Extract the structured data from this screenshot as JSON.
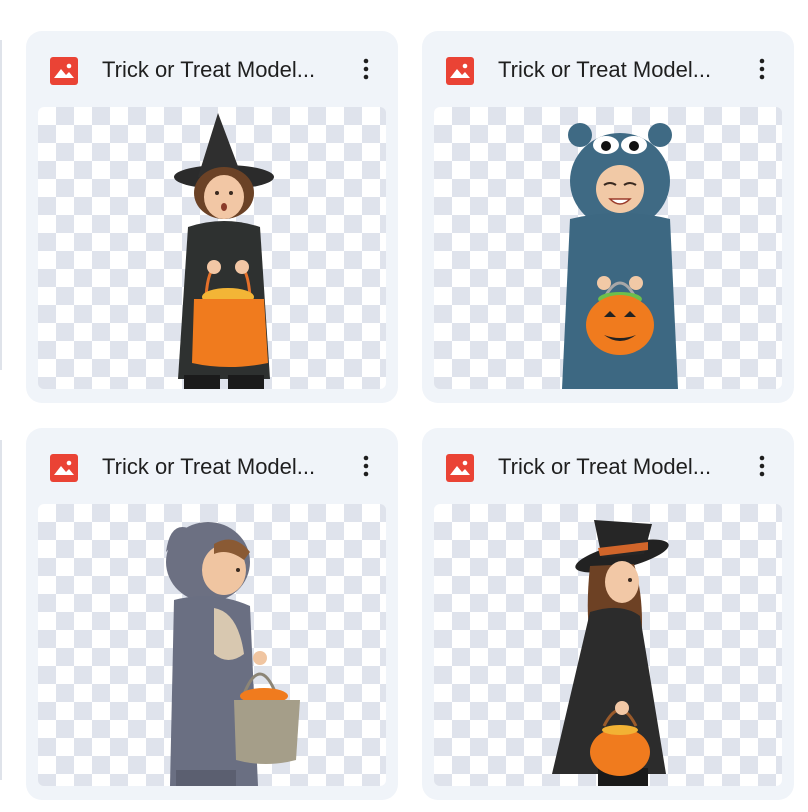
{
  "files": [
    {
      "title": "Trick or Treat Model...",
      "icon": "image-file-icon",
      "costume": "witch-with-orange-bag"
    },
    {
      "title": "Trick or Treat Model...",
      "icon": "image-file-icon",
      "costume": "blue-monster-with-pumpkin"
    },
    {
      "title": "Trick or Treat Model...",
      "icon": "image-file-icon",
      "costume": "grey-animal-with-bag"
    },
    {
      "title": "Trick or Treat Model...",
      "icon": "image-file-icon",
      "costume": "witch-with-pumpkin"
    }
  ],
  "colors": {
    "card_bg": "#f0f4f9",
    "icon_red": "#ea4335",
    "checker": "#dfe3ec",
    "orange": "#f07b1e"
  }
}
